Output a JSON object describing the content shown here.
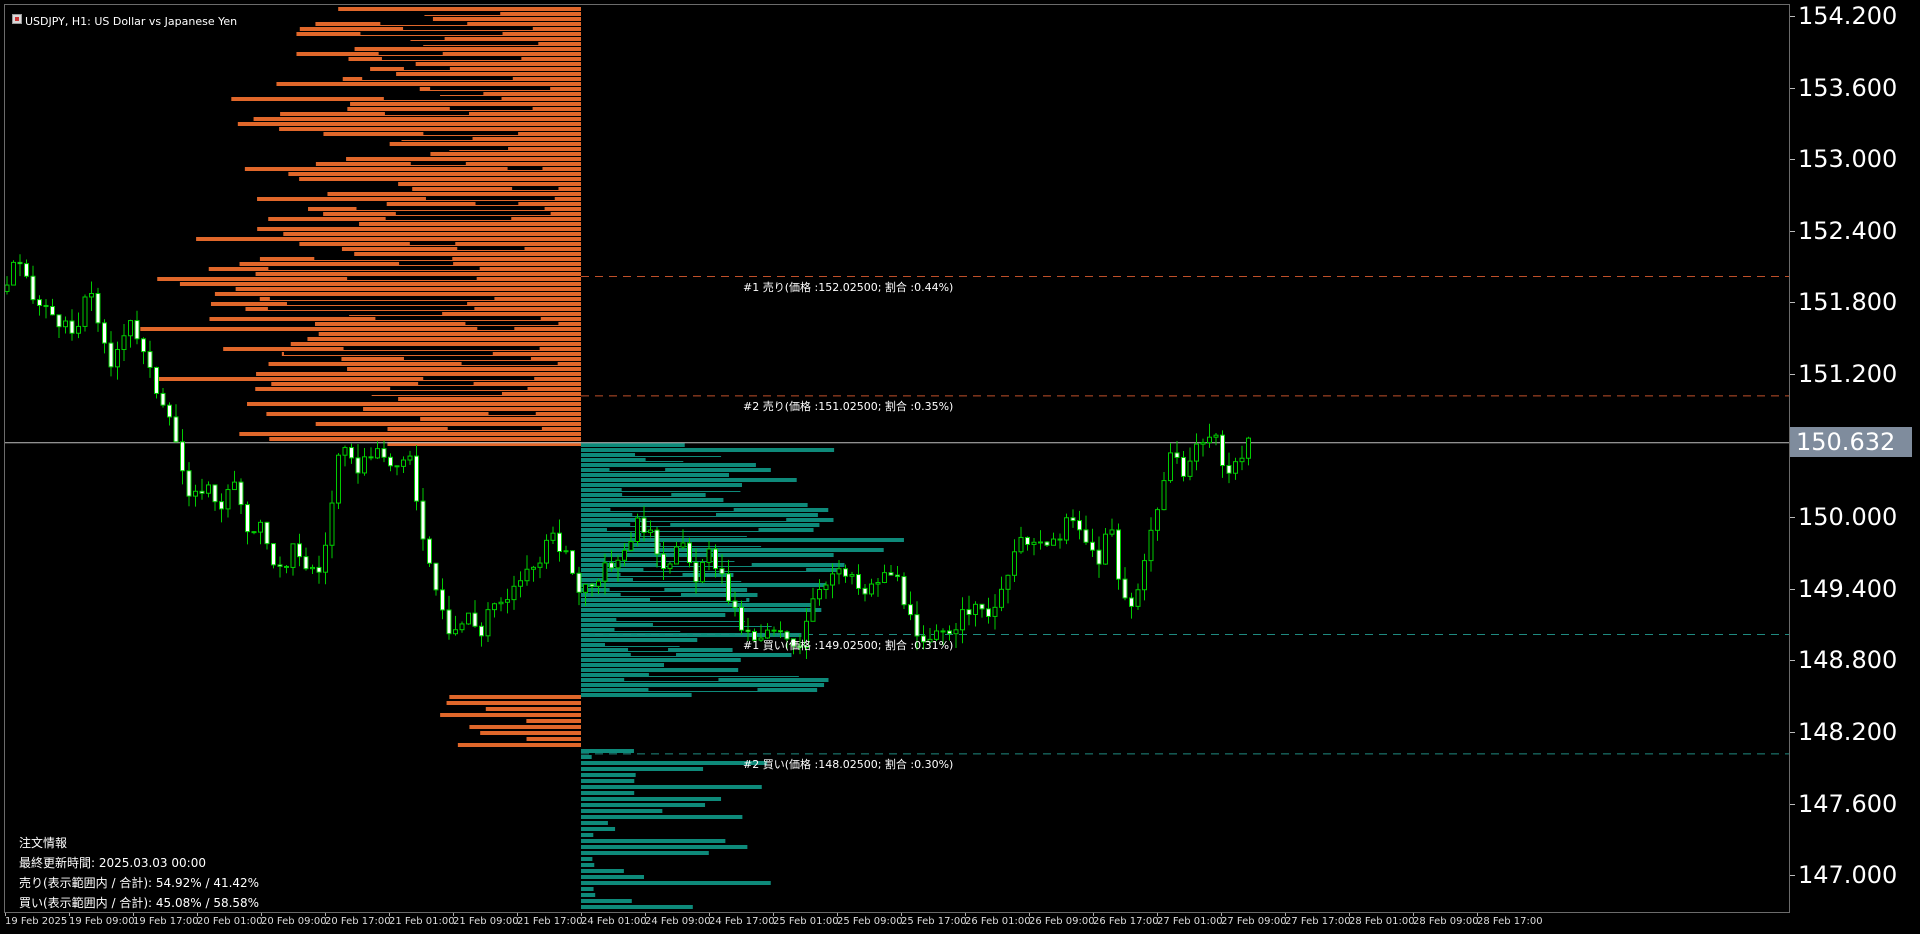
{
  "window": {
    "title": "USDJPY, H1:  US Dollar vs Japanese Yen"
  },
  "price_axis": {
    "labels": [
      "154.200",
      "153.600",
      "153.000",
      "152.400",
      "151.800",
      "151.200",
      "150.000",
      "149.400",
      "148.800",
      "148.200",
      "147.600",
      "147.000"
    ],
    "current_price": "150.632"
  },
  "time_axis": {
    "labels": [
      "19 Feb 2025",
      "19 Feb 09:00",
      "19 Feb 17:00",
      "20 Feb 01:00",
      "20 Feb 09:00",
      "20 Feb 17:00",
      "21 Feb 01:00",
      "21 Feb 09:00",
      "21 Feb 17:00",
      "24 Feb 01:00",
      "24 Feb 09:00",
      "24 Feb 17:00",
      "25 Feb 01:00",
      "25 Feb 09:00",
      "25 Feb 17:00",
      "26 Feb 01:00",
      "26 Feb 09:00",
      "26 Feb 17:00",
      "27 Feb 01:00",
      "27 Feb 09:00",
      "27 Feb 17:00",
      "28 Feb 01:00",
      "28 Feb 09:00",
      "28 Feb 17:00"
    ]
  },
  "levels": [
    {
      "label": "#1 売り(価格 :152.02500; 割合 :0.44%)",
      "price": 152.025,
      "color": "#c0502a"
    },
    {
      "label": "#2 売り(価格 :151.02500; 割合 :0.35%)",
      "price": 151.025,
      "color": "#c0502a"
    },
    {
      "label": "#1 買い(価格 :149.02500; 割合 :0.31%)",
      "price": 149.025,
      "color": "#1f8a80"
    },
    {
      "label": "#2 買い(価格 :148.02500; 割合 :0.30%)",
      "price": 148.025,
      "color": "#1f8a80"
    }
  ],
  "info_panel": {
    "title": "注文情報",
    "updated": "最終更新時間: 2025.03.03 00:00",
    "sell": "売り(表示範囲内 / 合計): 54.92% / 41.42%",
    "buy": "買い(表示範囲内 / 合計): 45.08% / 58.58%"
  },
  "colors": {
    "sell": "#e0672a",
    "buy": "#0e8a7a",
    "candle_up": "#00cc00",
    "candle_down": "#ffffff",
    "background": "#000000",
    "current_price_line": "#c0c0c0"
  },
  "chart_data": {
    "type": "candlestick",
    "symbol": "USDJPY",
    "timeframe": "H1",
    "ylim": [
      146.8,
      154.3
    ],
    "current_price": 150.632,
    "price_anchors": [
      [
        0,
        151.9
      ],
      [
        10,
        152.2
      ],
      [
        30,
        151.8
      ],
      [
        50,
        151.7
      ],
      [
        70,
        151.5
      ],
      [
        85,
        151.95
      ],
      [
        95,
        151.6
      ],
      [
        105,
        151.2
      ],
      [
        115,
        151.5
      ],
      [
        125,
        151.7
      ],
      [
        135,
        151.45
      ],
      [
        150,
        151.1
      ],
      [
        165,
        150.9
      ],
      [
        175,
        150.5
      ],
      [
        185,
        150.1
      ],
      [
        200,
        150.3
      ],
      [
        215,
        150.1
      ],
      [
        230,
        150.3
      ],
      [
        240,
        149.9
      ],
      [
        255,
        149.95
      ],
      [
        265,
        149.7
      ],
      [
        280,
        149.5
      ],
      [
        290,
        149.8
      ],
      [
        300,
        149.6
      ],
      [
        315,
        149.55
      ],
      [
        325,
        150.0
      ],
      [
        335,
        150.6
      ],
      [
        350,
        150.4
      ],
      [
        365,
        150.55
      ],
      [
        380,
        150.5
      ],
      [
        395,
        150.4
      ],
      [
        405,
        150.5
      ],
      [
        415,
        150.0
      ],
      [
        425,
        149.6
      ],
      [
        435,
        149.35
      ],
      [
        445,
        149.05
      ],
      [
        455,
        149.1
      ],
      [
        465,
        149.2
      ],
      [
        475,
        149.0
      ],
      [
        485,
        149.3
      ],
      [
        500,
        149.25
      ],
      [
        515,
        149.5
      ],
      [
        530,
        149.6
      ],
      [
        545,
        149.85
      ],
      [
        560,
        149.7
      ],
      [
        575,
        149.4
      ],
      [
        590,
        149.5
      ],
      [
        605,
        149.6
      ],
      [
        620,
        149.75
      ],
      [
        635,
        150.0
      ],
      [
        645,
        149.85
      ],
      [
        660,
        149.6
      ],
      [
        675,
        149.8
      ],
      [
        690,
        149.5
      ],
      [
        705,
        149.7
      ],
      [
        715,
        149.55
      ],
      [
        725,
        149.3
      ],
      [
        735,
        149.1
      ],
      [
        750,
        148.95
      ],
      [
        765,
        149.05
      ],
      [
        780,
        149.0
      ],
      [
        795,
        148.95
      ],
      [
        805,
        149.3
      ],
      [
        815,
        149.45
      ],
      [
        830,
        149.55
      ],
      [
        845,
        149.5
      ],
      [
        860,
        149.35
      ],
      [
        875,
        149.5
      ],
      [
        890,
        149.55
      ],
      [
        900,
        149.3
      ],
      [
        910,
        149.0
      ],
      [
        920,
        148.9
      ],
      [
        935,
        149.05
      ],
      [
        950,
        149.1
      ],
      [
        965,
        149.25
      ],
      [
        980,
        149.2
      ],
      [
        995,
        149.3
      ],
      [
        1005,
        149.6
      ],
      [
        1020,
        149.85
      ],
      [
        1035,
        149.75
      ],
      [
        1050,
        149.8
      ],
      [
        1065,
        150.0
      ],
      [
        1080,
        149.8
      ],
      [
        1095,
        149.65
      ],
      [
        1105,
        150.0
      ],
      [
        1115,
        149.4
      ],
      [
        1125,
        149.25
      ],
      [
        1135,
        149.5
      ],
      [
        1145,
        149.85
      ],
      [
        1155,
        150.2
      ],
      [
        1165,
        150.5
      ],
      [
        1180,
        150.4
      ],
      [
        1195,
        150.65
      ],
      [
        1210,
        150.7
      ],
      [
        1220,
        150.35
      ],
      [
        1230,
        150.5
      ],
      [
        1245,
        150.63
      ]
    ]
  }
}
